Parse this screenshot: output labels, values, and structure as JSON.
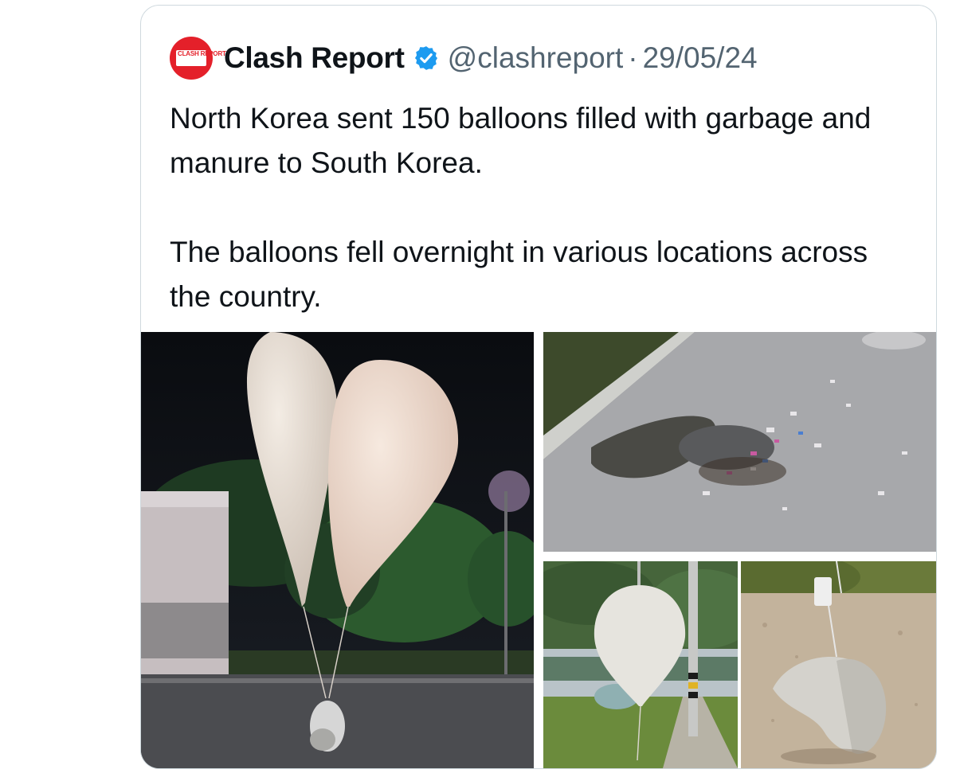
{
  "tweet": {
    "avatar_text": "CLASH REPORT",
    "display_name": "Clash Report",
    "verified_icon": "verified-badge-icon",
    "handle": "@clashreport",
    "separator": "·",
    "date": "29/05/24",
    "paragraphs": [
      "North Korea sent 150 balloons filled with garbage and manure to South Korea.",
      "The balloons fell overnight in various locations across the country."
    ]
  },
  "media": {
    "photos": [
      {
        "name": "balloons-at-night"
      },
      {
        "name": "scattered-garbage-on-road"
      },
      {
        "name": "balloon-near-pole"
      },
      {
        "name": "bag-on-gravel"
      }
    ]
  },
  "colors": {
    "brand_red": "#e4202a",
    "verified_blue": "#1d9bf0",
    "muted_text": "#536471",
    "border": "#cfd9de"
  }
}
